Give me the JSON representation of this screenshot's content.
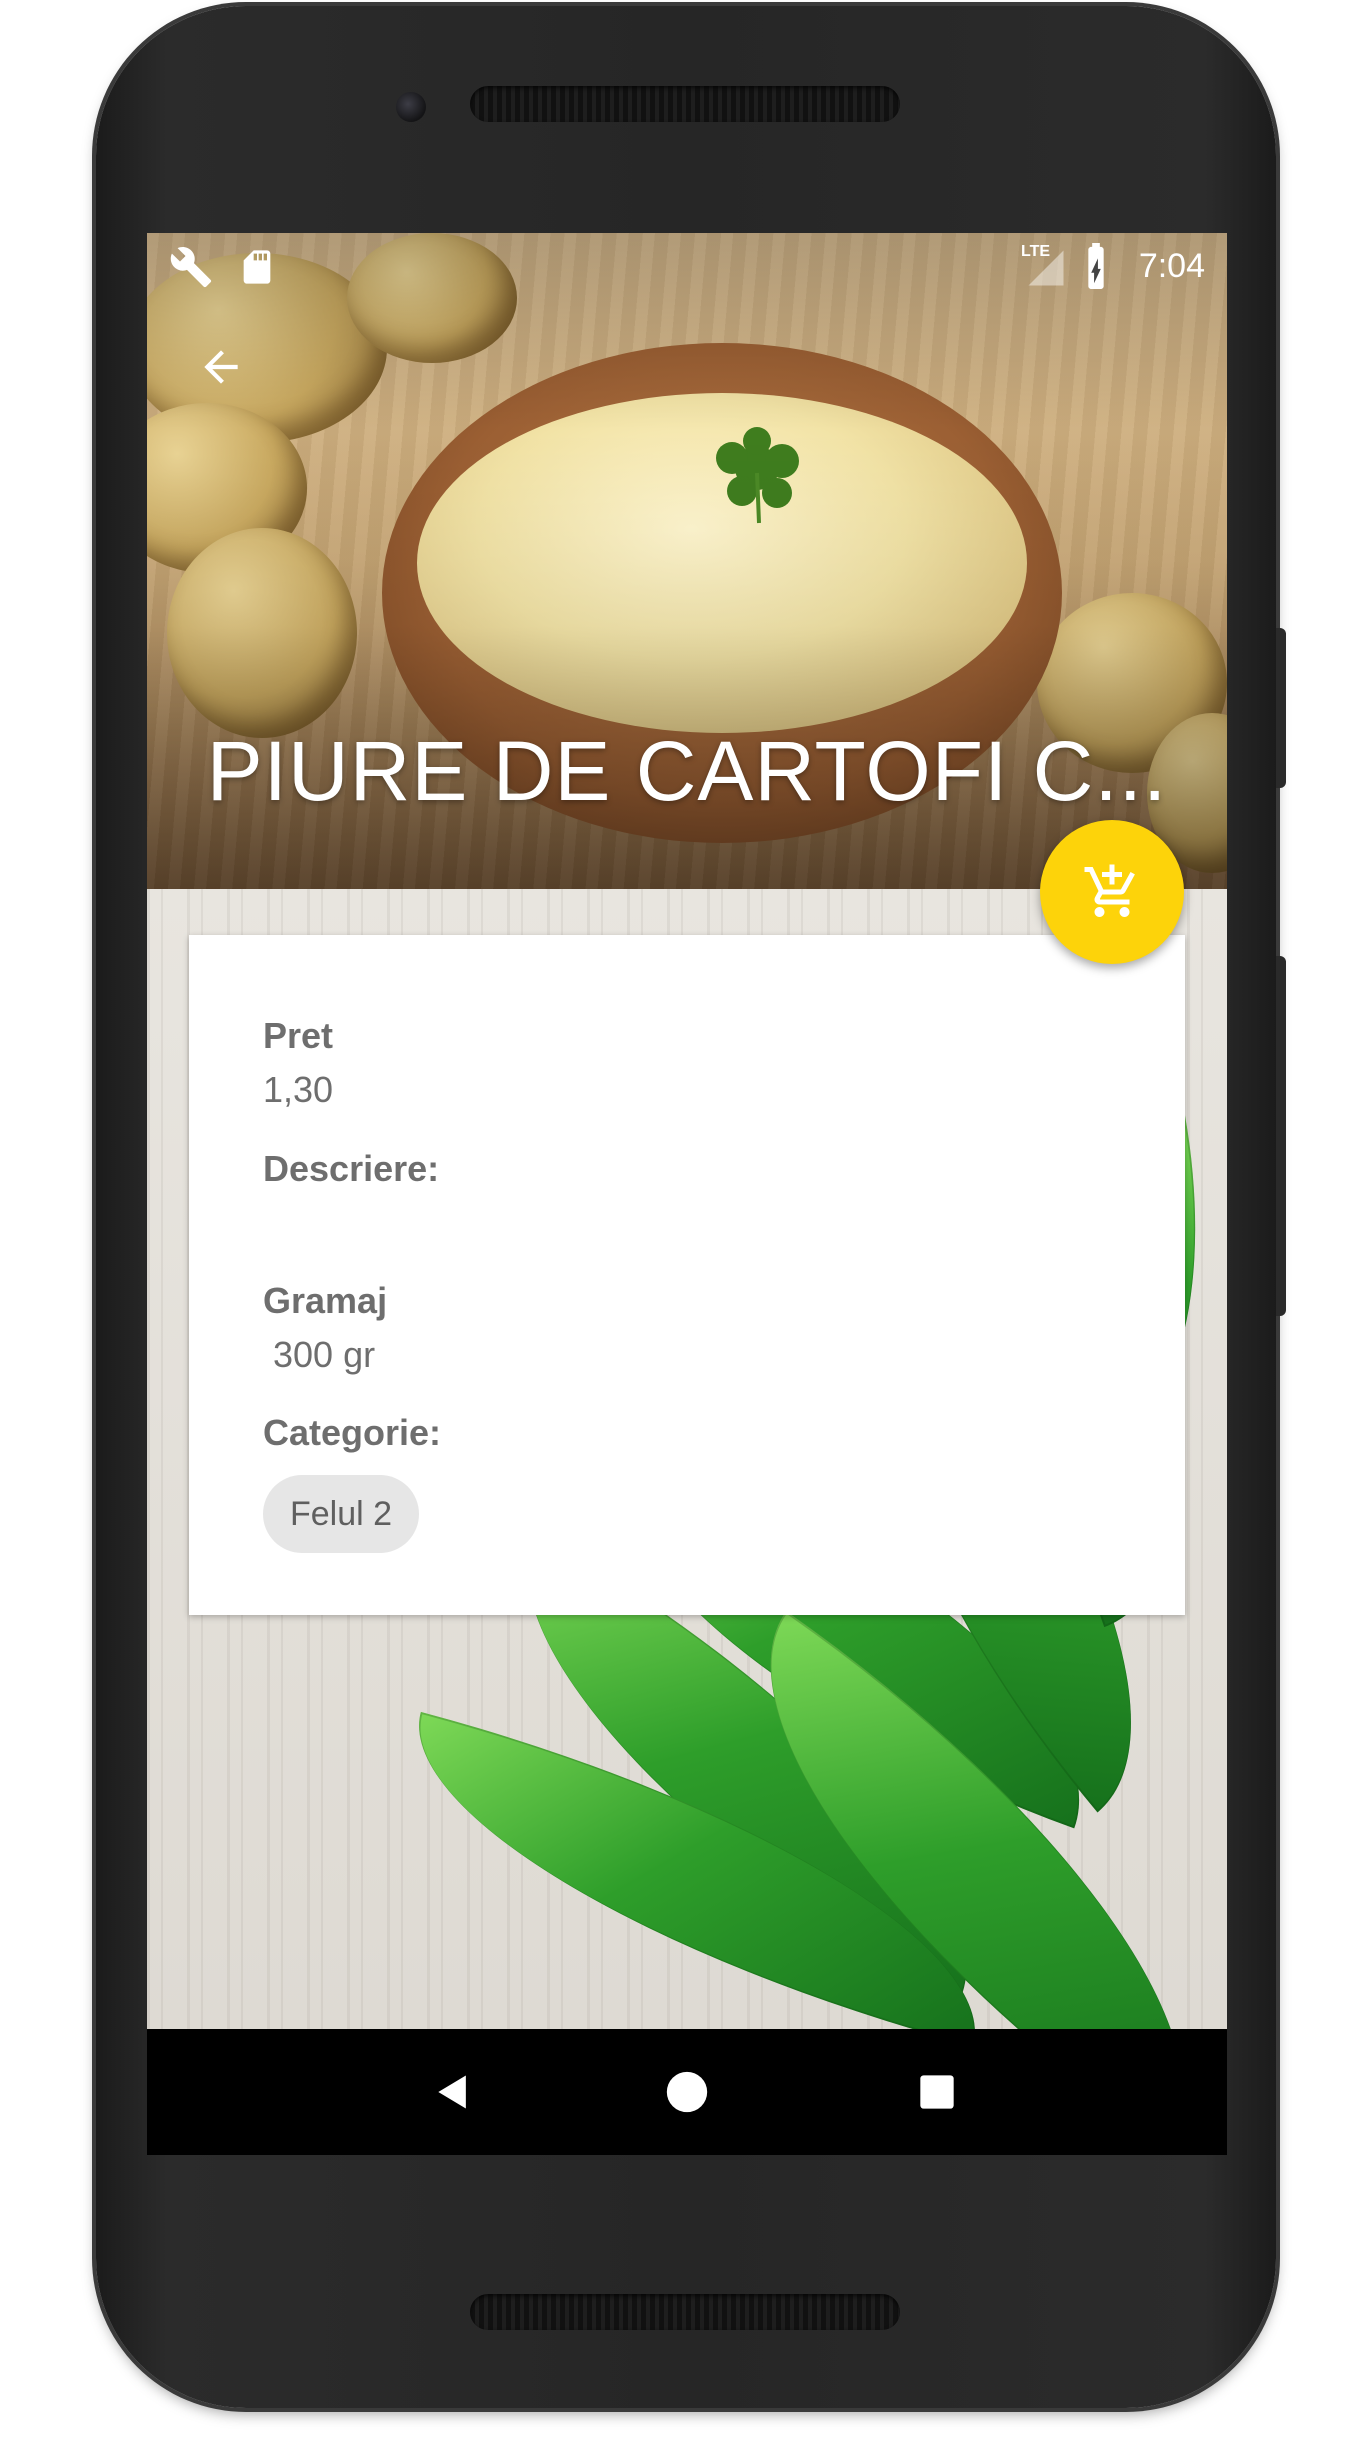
{
  "status_bar": {
    "time": "7:04",
    "network": "LTE",
    "left_icons": [
      "wrench-icon",
      "sd-card-icon"
    ],
    "right_icons": [
      "signal-icon",
      "battery-charging-icon"
    ]
  },
  "toolbar": {
    "back_icon": "arrow-back-icon",
    "title": "PIURE DE CARTOFI C..."
  },
  "fab": {
    "icon": "add-shopping-cart-icon",
    "color": "#fdd30a"
  },
  "details": {
    "price_label": "Pret",
    "price_value": "1,30",
    "description_label": "Descriere:",
    "description_value": "",
    "weight_label": "Gramaj",
    "weight_value": " 300 gr",
    "category_label": "Categorie:",
    "category_chip": "Felul 2"
  },
  "nav_bar": {
    "icons": [
      "nav-back-icon",
      "nav-home-icon",
      "nav-recents-icon"
    ]
  }
}
